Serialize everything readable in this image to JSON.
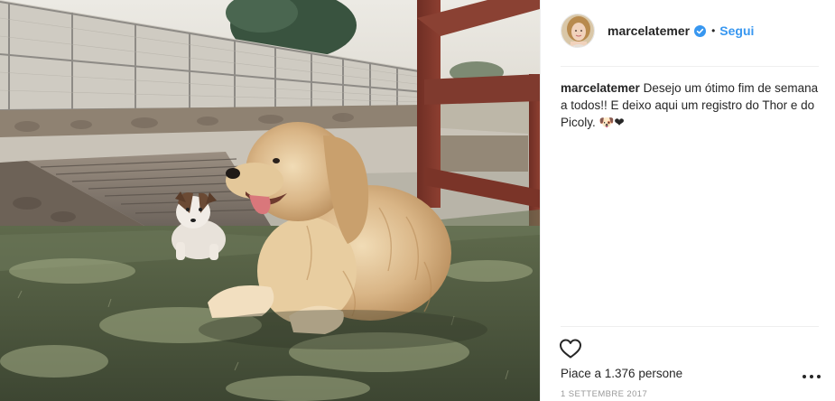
{
  "post": {
    "username": "marcelatemer",
    "separator": "•",
    "follow_label": "Segui",
    "caption_user": "marcelatemer",
    "caption_text": "Desejo um ótimo fim de semana a todos!! E deixo aqui um registro do Thor e do Picoly. 🐶❤",
    "likes_text": "Piace a 1.376 persone",
    "date": "1 settembre 2017"
  },
  "icons": {
    "verified": "verified-badge-icon",
    "heart": "heart-outline-icon",
    "more": "more-options-icon"
  },
  "colors": {
    "link_blue": "#3897f0",
    "verified_blue": "#3897f0",
    "divider": "#efefef",
    "muted": "#999999"
  }
}
